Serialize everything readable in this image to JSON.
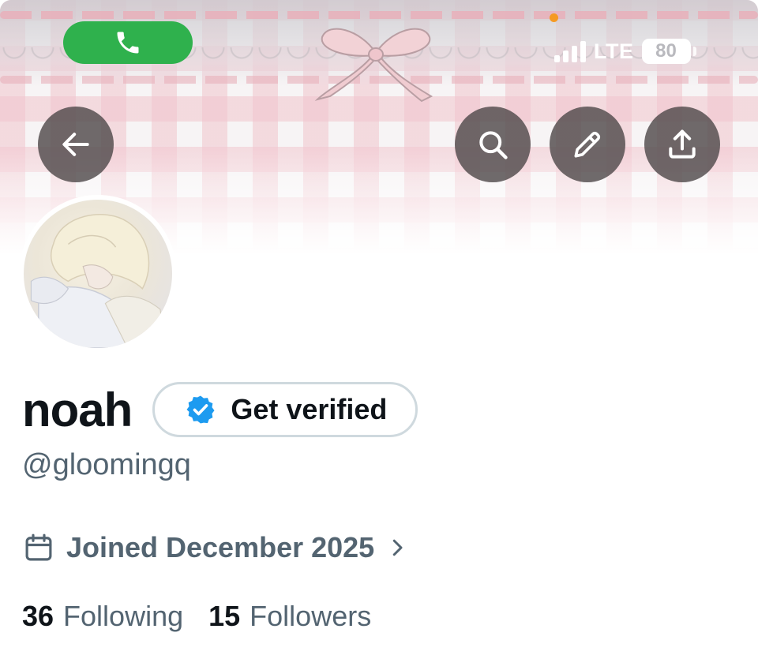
{
  "status_bar": {
    "network": "LTE",
    "battery": "80",
    "call_icon": "phone-icon"
  },
  "nav": {
    "back_icon": "arrow-left-icon",
    "search_icon": "search-icon",
    "edit_icon": "pencil-icon",
    "share_icon": "share-upload-icon"
  },
  "profile": {
    "display_name": "noah",
    "handle": "@gloomingq",
    "verify_button": "Get verified",
    "joined": "Joined December 2025",
    "following_count": "36",
    "following_label": "Following",
    "followers_count": "15",
    "followers_label": "Followers"
  },
  "colors": {
    "call_green": "#2fb14d",
    "verified_blue": "#1d9bf0",
    "text_primary": "#0f1419",
    "text_secondary": "#536471",
    "banner_pink": "#f1c4cd"
  }
}
